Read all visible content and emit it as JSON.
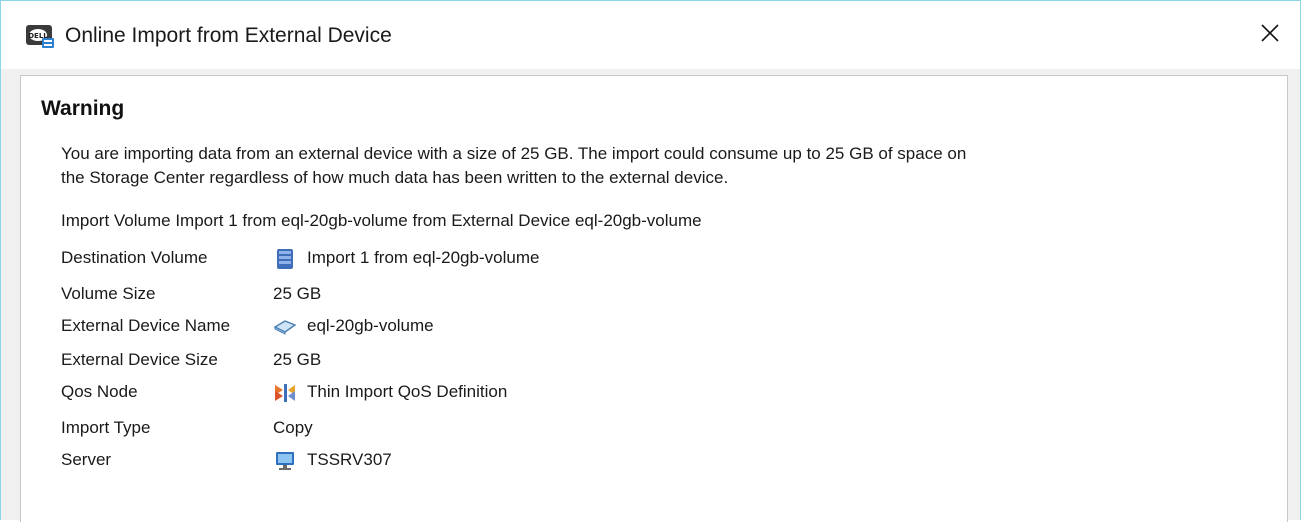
{
  "window": {
    "title": "Online Import from External Device",
    "app_icon": "dell-storage-app-icon",
    "close_icon": "close-icon"
  },
  "content": {
    "heading": "Warning",
    "message_line1": "You are importing data from an external device with a size of 25 GB. The import could consume up to 25 GB of space on",
    "message_line2": "the Storage Center regardless of how much data has been written to the external device.",
    "import_summary": "Import Volume Import 1 from eql-20gb-volume from External Device eql-20gb-volume",
    "details": {
      "destination_volume": {
        "label": "Destination Volume",
        "value": "Import 1 from eql-20gb-volume",
        "icon": "volume-icon"
      },
      "volume_size": {
        "label": "Volume Size",
        "value": "25 GB"
      },
      "external_device_name": {
        "label": "External Device Name",
        "value": "eql-20gb-volume",
        "icon": "external-device-icon"
      },
      "external_device_size": {
        "label": "External Device Size",
        "value": "25 GB"
      },
      "qos_node": {
        "label": "Qos Node",
        "value": "Thin Import QoS Definition",
        "icon": "qos-definition-icon"
      },
      "import_type": {
        "label": "Import Type",
        "value": "Copy"
      },
      "server": {
        "label": "Server",
        "value": "TSSRV307",
        "icon": "server-icon"
      }
    }
  },
  "colors": {
    "window_border": "#8fd3e6",
    "panel_border": "#c8c8c8",
    "dialog_background": "#f0f0f0"
  }
}
